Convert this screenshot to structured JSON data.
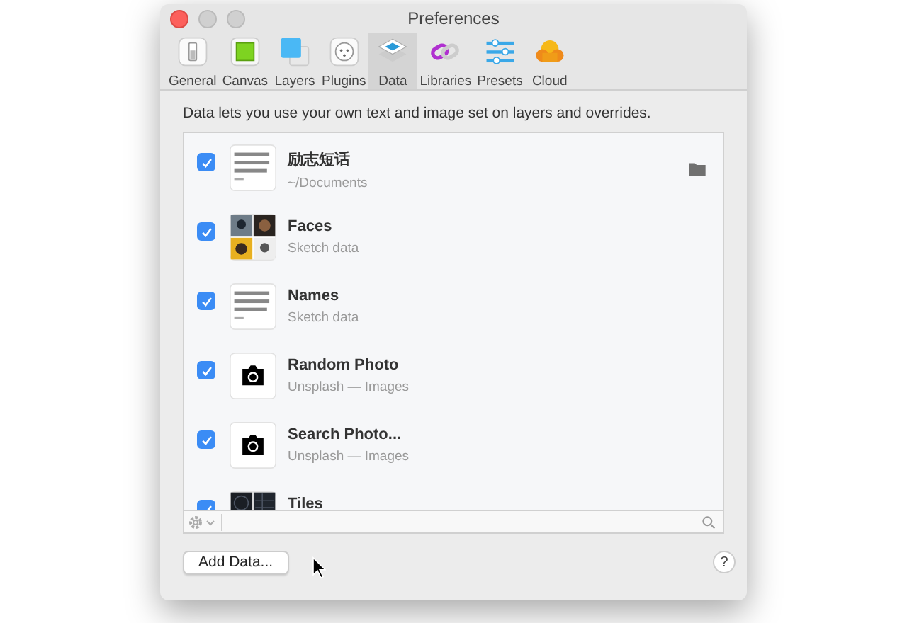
{
  "window": {
    "title": "Preferences"
  },
  "tabs": [
    {
      "label": "General",
      "kind": "general",
      "selected": false
    },
    {
      "label": "Canvas",
      "kind": "canvas",
      "selected": false
    },
    {
      "label": "Layers",
      "kind": "layers",
      "selected": false
    },
    {
      "label": "Plugins",
      "kind": "plugins",
      "selected": false
    },
    {
      "label": "Data",
      "kind": "data",
      "selected": true
    },
    {
      "label": "Libraries",
      "kind": "libraries",
      "selected": false
    },
    {
      "label": "Presets",
      "kind": "presets",
      "selected": false
    },
    {
      "label": "Cloud",
      "kind": "cloud",
      "selected": false
    }
  ],
  "description": "Data lets you use your own text and image set on layers and overrides.",
  "data_sources": [
    {
      "title": "励志短话",
      "subtitle": "~/Documents",
      "checked": true,
      "kind": "text",
      "folder": true
    },
    {
      "title": "Faces",
      "subtitle": "Sketch data",
      "checked": true,
      "kind": "photos",
      "folder": false
    },
    {
      "title": "Names",
      "subtitle": "Sketch data",
      "checked": true,
      "kind": "text",
      "folder": false
    },
    {
      "title": "Random Photo",
      "subtitle": "Unsplash — Images",
      "checked": true,
      "kind": "camera",
      "folder": false
    },
    {
      "title": "Search Photo...",
      "subtitle": "Unsplash — Images",
      "checked": true,
      "kind": "camera",
      "folder": false
    },
    {
      "title": "Tiles",
      "checked": true,
      "kind": "tiles",
      "folder": false
    }
  ],
  "buttons": {
    "add": "Add Data...",
    "help": "?"
  }
}
